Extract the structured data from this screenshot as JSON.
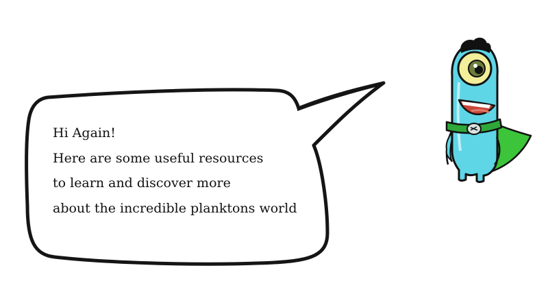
{
  "speech_bubble": {
    "lines": [
      "Hi Again!",
      "Here are some useful resources",
      "to learn and discover more",
      "about the incredible planktons world"
    ]
  },
  "mascot": {
    "icon": "plankton-superhero-mascot-icon",
    "colors": {
      "body": "#5fd6e6",
      "cape": "#3cc43a",
      "belt": "#2fa83a",
      "eye": "#f3ee9a",
      "pupil": "#6d7d3a",
      "mouth": "#c9473a",
      "outline": "#111111"
    }
  }
}
